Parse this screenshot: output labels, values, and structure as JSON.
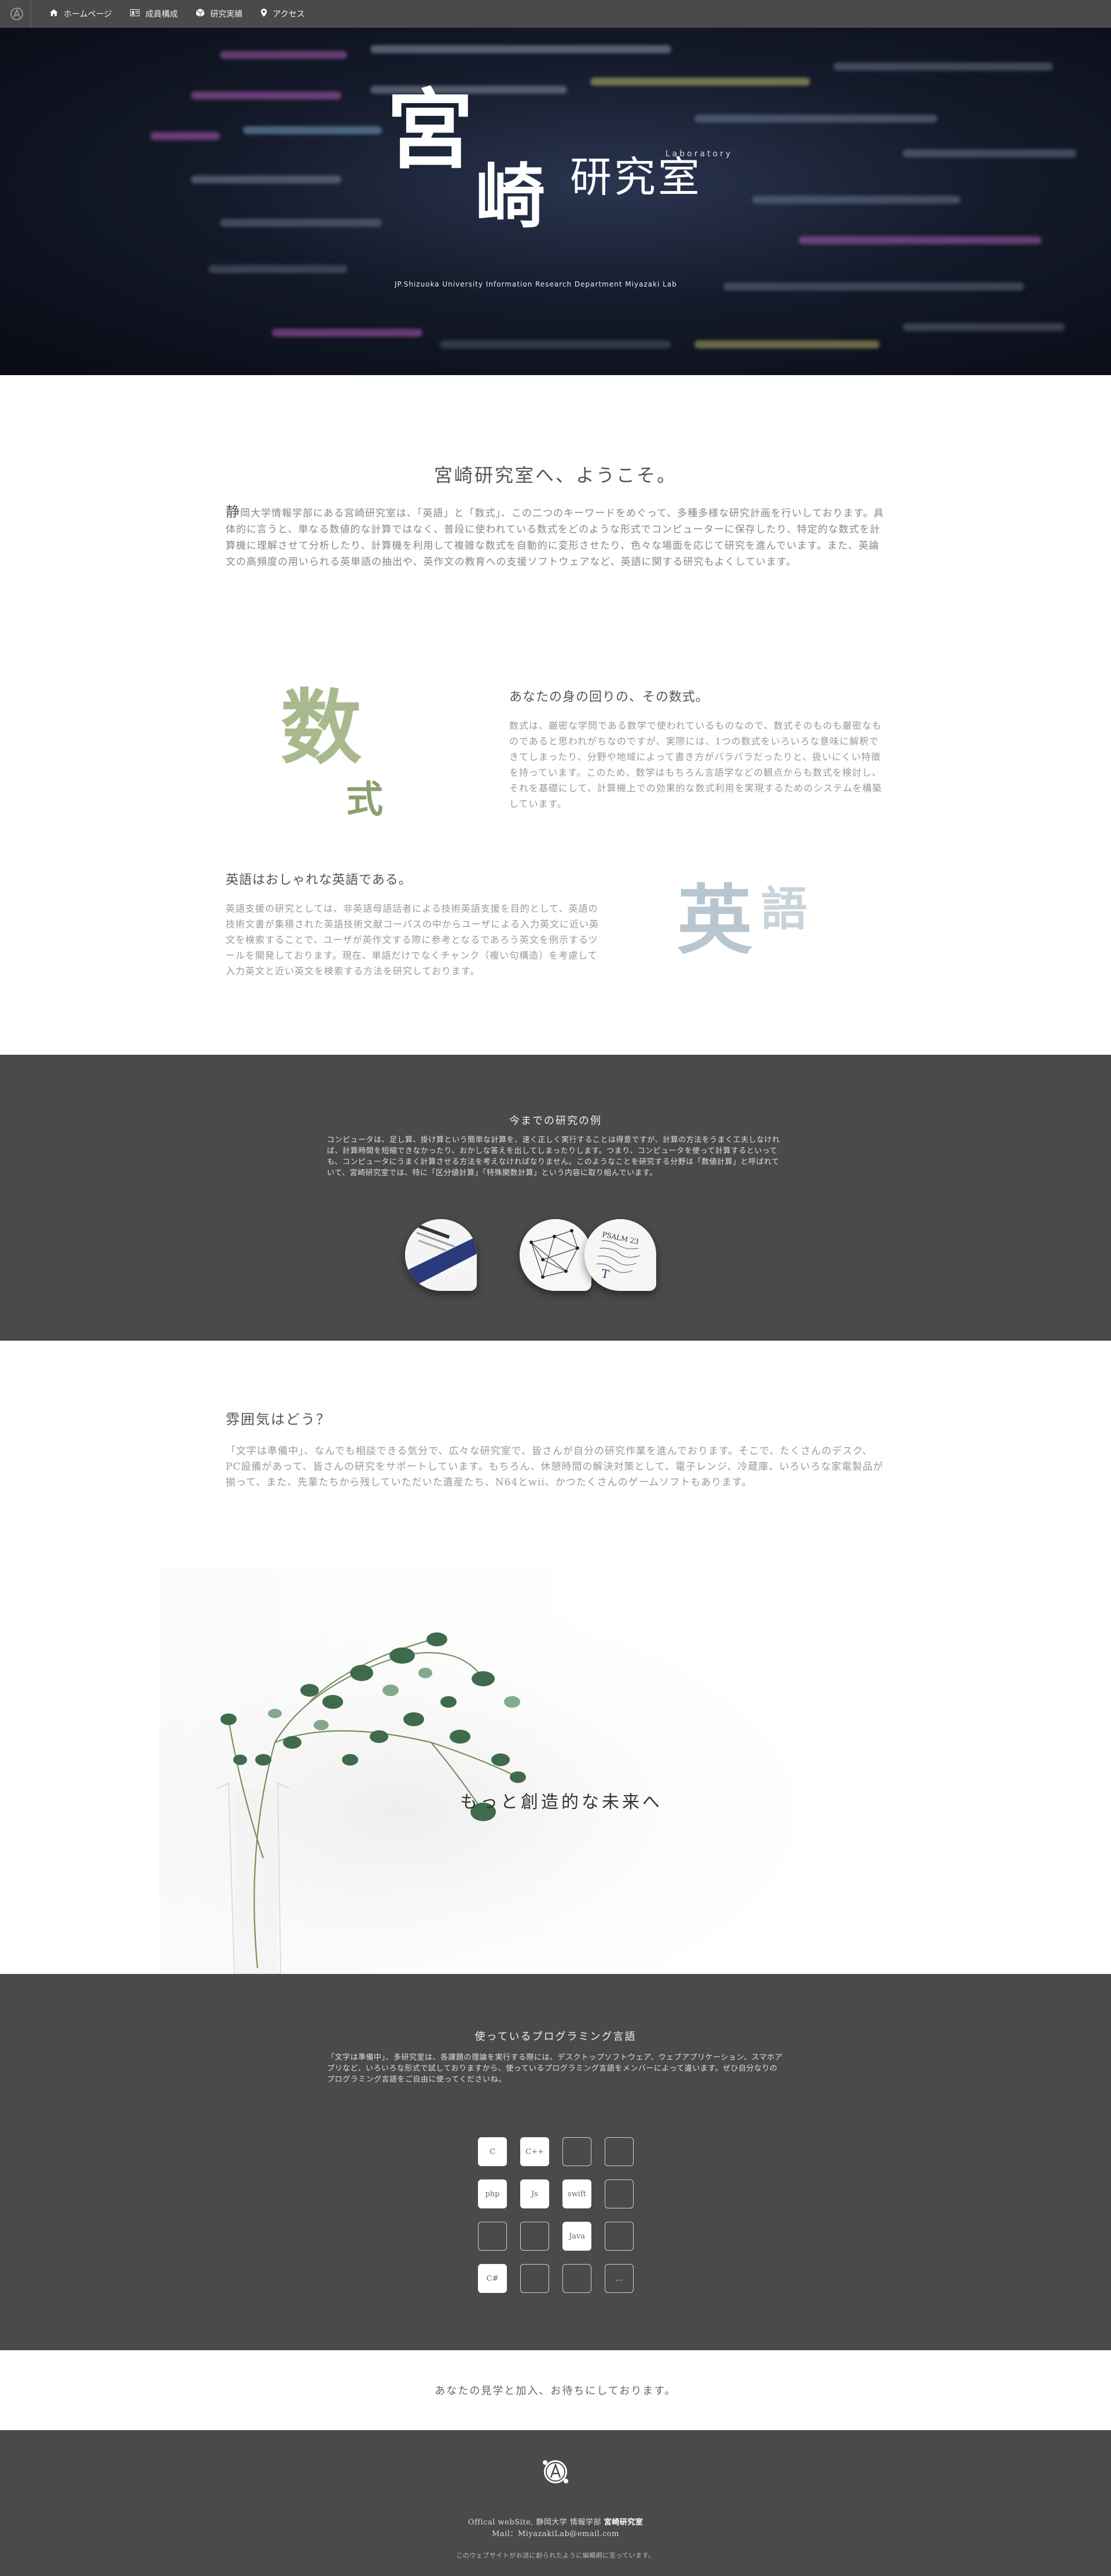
{
  "nav": {
    "items": [
      {
        "icon": "home-icon",
        "label": "ホームページ"
      },
      {
        "icon": "id-card-icon",
        "label": "成員構成"
      },
      {
        "icon": "cube-icon",
        "label": "研究実績"
      },
      {
        "icon": "map-pin-icon",
        "label": "アクセス"
      }
    ]
  },
  "hero": {
    "kanji_top": "宮",
    "kanji_bottom": "崎",
    "laboratory": "Laboratory",
    "title": "研究室",
    "subtitle": "JP.Shizuoka University Information Research Department Miyazaki Lab"
  },
  "welcome": {
    "title": "宮崎研究室へ、ようこそ。",
    "lead": "静",
    "text": "岡大学情報学部にある宮崎研究室は、「英語」と「数式」、この二つのキーワードをめぐって、多種多様な研究計画を行いしております。具体的に言うと、単なる数値的な計算ではなく、普段に使われている数式をどのような形式でコンピューターに保存したり、特定的な数式を計算機に理解させて分析したり、計算機を利用して複雑な数式を自動的に変形させたり、色々な場面を応じて研究を進んでいます。また、英論文の高頻度の用いられる英単語の抽出や、英作文の教育への支援ソフトウェアなど、英語に関する研究もよくしています。"
  },
  "features": {
    "math": {
      "art_main": "数",
      "art_sub": "式",
      "heading": "あなたの身の回りの、その数式。",
      "text": "数式は、厳密な学問である数学で使われているものなので、数式そのものも厳密なものであると思われがちなのですが、実際には、1つの数式をいろいろな意味に解釈できてしまったり、分野や地域によって書き方がバラバラだったりと、扱いにくい特徴を持っています。このため、数学はもちろん言語学などの観点からも数式を検討し、それを基礎にして、計算機上での効果的な数式利用を実現するためのシステムを構築しています。"
    },
    "english": {
      "art_main": "英",
      "art_sub": "語",
      "heading": "英語はおしゃれな英語である。",
      "text": "英語支援の研究としては、非英語母語話者による技術英語支援を目的として、英語の技術文書が集積された英語技術文献コーパスの中からユーザによる入力英文に近い英文を検索することで、ユーザが英作文する際に参考となるであろう英文を例示するツールを開発しております。現在、単語だけでなくチャンク（複い句構造）を考慮して入力英文と近い英文を検索する方法を研究しております。"
    }
  },
  "research": {
    "title": "今までの研究の例",
    "text": "コンピュータは、足し算、掛け算という簡単な計算を、速く正しく実行することは得意ですが、計算の方法をうまく工夫しなければ、計算時間を短縮できなかったり、おかしな答えを出してしまったりします。つまり、コンピュータを使って計算するといっても、コンピュータにうまく計算させる方法を考えなければなりません。このようなことを研究する分野は「数値計算」と呼ばれていて、宮崎研究室では、特に「区分値計算」「特殊関数計算」という内容に取り組んでいます。",
    "thumbs": [
      {
        "name": "document-thumbnail",
        "caption": "Example"
      },
      {
        "name": "network-graph-thumbnail",
        "caption": ""
      },
      {
        "name": "handwriting-thumbnail",
        "caption": "PSALM 23"
      }
    ]
  },
  "atmosphere": {
    "title": "雰囲気はどう？",
    "text": "「文字は準備中」、なんでも相談できる気分で、広々な研究室で、皆さんが自分の研究作業を進んでおります。そこで、たくさんのデスク、PC設備があって、皆さんの研究をサポートしています。もちろん、休憩時間の解決対策として、電子レンジ、冷蔵庫、いろいろな家電製品が揃って、また、先輩たちから残していただいた遺産たち、N64とwii、かつたくさんのゲームソフトもあります。"
  },
  "plant": {
    "caption": "もっと創造的な未来へ"
  },
  "languages": {
    "title": "使っているプログラミング言語",
    "text": "「文字は準備中」、多研究室は、各課題の理論を実行する際には、デスクトップソフトウェア、ウェブアプリケーション、スマホアプリなど、いろいろな形式で試しておりますから、使っているプログラミング言語をメンバーによって違います。ぜひ自分なりのプログラミング言語をご自由に使ってくださいね。",
    "grid": [
      [
        "C",
        "C++",
        "",
        ""
      ],
      [
        "php",
        "Js",
        "swift",
        ""
      ],
      [
        "",
        "",
        "Java",
        ""
      ],
      [
        "C#",
        "",
        "",
        "..."
      ]
    ]
  },
  "cta": {
    "text": "あなたの見学と加入、お待ちにしております。"
  },
  "footer": {
    "line1_prefix": "Offical webSite, 静岡大学 情報学部 ",
    "line1_bold": "宮崎研究室",
    "line2": "Mail：MiyazakiLab@email.com",
    "line3": "このウェブサイトがお送に創られたように編輯網に至っています。"
  }
}
